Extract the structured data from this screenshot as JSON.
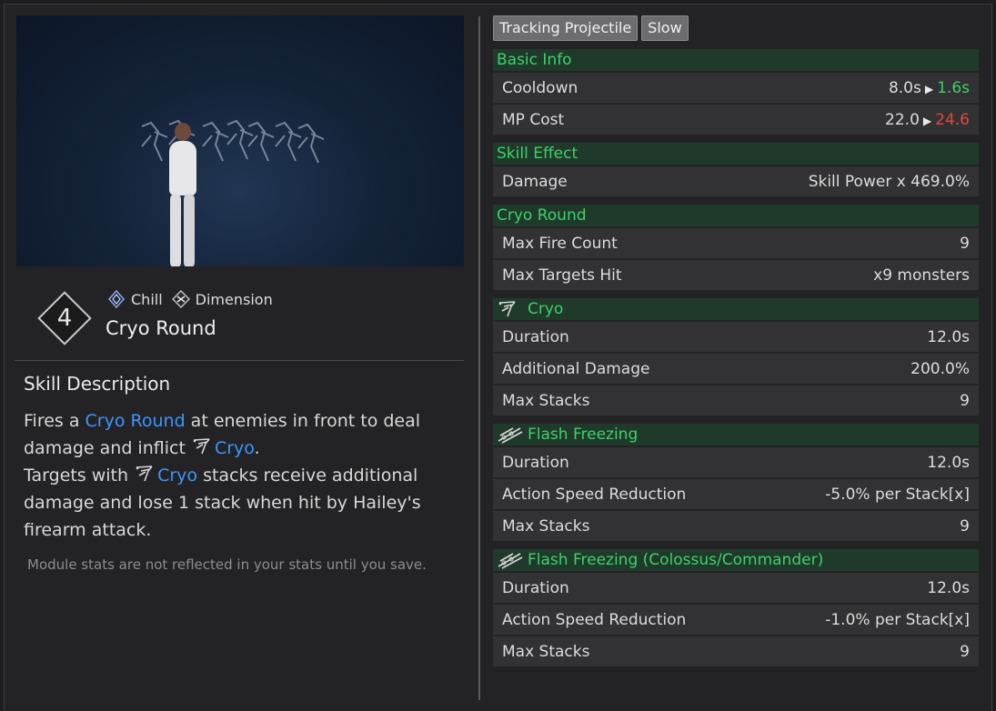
{
  "tags_top": [
    "Tracking Projectile",
    "Slow"
  ],
  "skill": {
    "slot": "4",
    "element": "Chill",
    "type": "Dimension",
    "name": "Cryo Round",
    "element_icon": "chill-icon",
    "type_icon": "dimension-icon"
  },
  "description": {
    "title": "Skill Description",
    "p1_a": "Fires a ",
    "p1_link": "Cryo Round",
    "p1_b": " at enemies in front to deal damage and inflict ",
    "p1_link2": "Cryo",
    "p1_c": ".",
    "p2_a": "Targets with ",
    "p2_link": "Cryo",
    "p2_b": " stacks receive additional damage and lose 1 stack when hit by Hailey's firearm attack.",
    "note": "Module stats are not reflected in your stats until you save."
  },
  "basic_info": {
    "title": "Basic Info",
    "cooldown_label": "Cooldown",
    "cooldown_base": "8.0s",
    "cooldown_new": "1.6s",
    "mp_label": "MP Cost",
    "mp_base": "22.0",
    "mp_new": "24.6"
  },
  "skill_effect": {
    "title": "Skill Effect",
    "damage_label": "Damage",
    "damage_value": "Skill Power x 469.0%"
  },
  "cryo_round": {
    "title": "Cryo Round",
    "fire_label": "Max Fire Count",
    "fire_value": "9",
    "targets_label": "Max Targets Hit",
    "targets_value": "x9 monsters"
  },
  "cryo": {
    "title": "Cryo",
    "duration_label": "Duration",
    "duration_value": "12.0s",
    "addl_label": "Additional Damage",
    "addl_value": "200.0%",
    "stacks_label": "Max Stacks",
    "stacks_value": "9"
  },
  "flash_freezing": {
    "title": "Flash Freezing",
    "duration_label": "Duration",
    "duration_value": "12.0s",
    "speed_label": "Action Speed Reduction",
    "speed_value": "-5.0% per Stack[x]",
    "stacks_label": "Max Stacks",
    "stacks_value": "9"
  },
  "flash_freezing_boss": {
    "title": "Flash Freezing (Colossus/Commander)",
    "duration_label": "Duration",
    "duration_value": "12.0s",
    "speed_label": "Action Speed Reduction",
    "speed_value": "-1.0% per Stack[x]",
    "stacks_label": "Max Stacks",
    "stacks_value": "9"
  },
  "colors": {
    "section_green": "#3fd06a",
    "highlight_blue": "#3d95ff",
    "increase_red": "#e2473b"
  }
}
